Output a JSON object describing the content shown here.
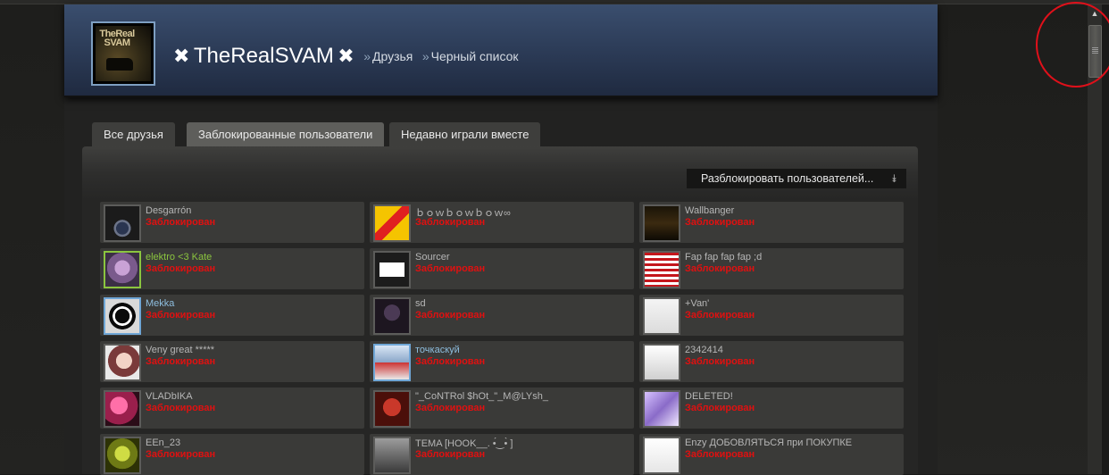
{
  "header": {
    "mark_left": "✖",
    "persona": "TheRealSVAM",
    "mark_right": "✖",
    "separator1": "»",
    "crumb1": "Друзья",
    "separator2": "»",
    "crumb2": "Черный список",
    "avatar_text": "TheReal SVAM"
  },
  "tabs": [
    {
      "label": "Все друзья"
    },
    {
      "label": "Заблокированные пользователи"
    },
    {
      "label": "Недавно играли вместе"
    }
  ],
  "unblock_button": {
    "label": "Разблокировать пользователей...",
    "icon": "double-chevron-down-icon"
  },
  "status_label": "Заблокирован",
  "friends": [
    {
      "name": "Desgarrón",
      "status": "Заблокирован",
      "color": "#b6b6b6"
    },
    {
      "name": "ｂｏｗｂｏｗｂｏｗ∞",
      "status": "Заблокирован",
      "color": "#b6b6b6"
    },
    {
      "name": "Wallbanger",
      "status": "Заблокирован",
      "color": "#b6b6b6"
    },
    {
      "name": "elektro <3 Kate",
      "status": "Заблокирован",
      "color": "#8bc53f"
    },
    {
      "name": "Sourcer",
      "status": "Заблокирован",
      "color": "#b6b6b6"
    },
    {
      "name": "Fap fap fap fap ;d",
      "status": "Заблокирован",
      "color": "#b6b6b6"
    },
    {
      "name": "Mekka",
      "status": "Заблокирован",
      "color": "#8ebedf"
    },
    {
      "name": "sd",
      "status": "Заблокирован",
      "color": "#b6b6b6"
    },
    {
      "name": "+Van'",
      "status": "Заблокирован",
      "color": "#b6b6b6"
    },
    {
      "name": "Veny great *****",
      "status": "Заблокирован",
      "color": "#b6b6b6"
    },
    {
      "name": "точкаскуй",
      "status": "Заблокирован",
      "color": "#8ebedf"
    },
    {
      "name": "2342414",
      "status": "Заблокирован",
      "color": "#b6b6b6"
    },
    {
      "name": "VLADbIKA",
      "status": "Заблокирован",
      "color": "#b6b6b6"
    },
    {
      "name": "\"_CoNTRol $hOt_\"_M@LYsh_",
      "status": "Заблокирован",
      "color": "#b6b6b6"
    },
    {
      "name": "DELETED!",
      "status": "Заблокирован",
      "color": "#b6b6b6"
    },
    {
      "name": "EEn_23",
      "status": "Заблокирован",
      "color": "#b6b6b6"
    },
    {
      "name": "TEMA [HOOK__. •́‿•̀ ]",
      "status": "Заблокирован",
      "color": "#b6b6b6"
    },
    {
      "name": "Enzy ДОБОВЛЯТЬСЯ при ПОКУПКЕ",
      "status": "Заблокирован",
      "color": "#b6b6b6"
    }
  ],
  "colors": {
    "header_blue": "#2b3a55",
    "blocked_red": "#e01010",
    "ingame_green": "#8bc53f",
    "online_blue": "#8ebedf",
    "annotation_circle": "#e0101a"
  }
}
